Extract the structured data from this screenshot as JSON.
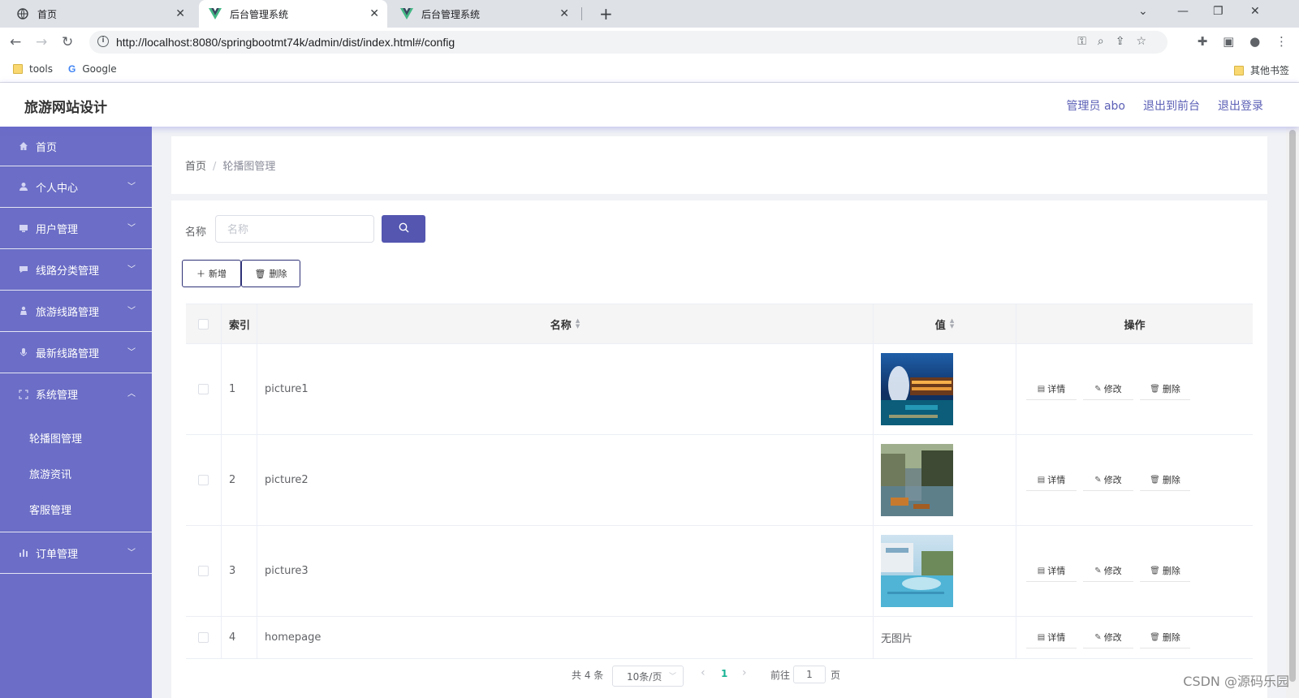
{
  "browser": {
    "tabs": [
      {
        "label": "首页",
        "icon": "globe-icon"
      },
      {
        "label": "后台管理系统",
        "icon": "vue-icon"
      },
      {
        "label": "后台管理系统",
        "icon": "vue-icon"
      }
    ],
    "url": "http://localhost:8080/springbootmt74k/admin/dist/index.html#/config",
    "bookmarks": [
      {
        "label": "tools",
        "icon": "folder-icon"
      },
      {
        "label": "Google",
        "icon": "google-icon"
      }
    ],
    "other_bookmarks": "其他书签"
  },
  "app": {
    "title": "旅游网站设计",
    "header_links": {
      "user": "管理员 abo",
      "to_front": "退出到前台",
      "logout": "退出登录"
    }
  },
  "sidebar": {
    "items": [
      {
        "label": "首页",
        "icon": "home-icon"
      },
      {
        "label": "个人中心",
        "icon": "user-icon"
      },
      {
        "label": "用户管理",
        "icon": "monitor-icon"
      },
      {
        "label": "线路分类管理",
        "icon": "chat-icon"
      },
      {
        "label": "旅游线路管理",
        "icon": "person-icon"
      },
      {
        "label": "最新线路管理",
        "icon": "mic-icon"
      },
      {
        "label": "系统管理",
        "icon": "fullscreen-icon"
      }
    ],
    "sub_items": [
      "轮播图管理",
      "旅游资讯",
      "客服管理"
    ],
    "last_item": {
      "label": "订单管理",
      "icon": "bar-chart-icon"
    }
  },
  "breadcrumb": {
    "home": "首页",
    "separator": "/",
    "current": "轮播图管理"
  },
  "search": {
    "label": "名称",
    "placeholder": "名称"
  },
  "actions": {
    "add": "新增",
    "delete": "删除"
  },
  "table": {
    "headers": {
      "index": "索引",
      "name": "名称",
      "value": "值",
      "ops": "操作"
    },
    "rows": [
      {
        "index": "1",
        "name": "picture1",
        "value": null,
        "image": "resort-night"
      },
      {
        "index": "2",
        "name": "picture2",
        "value": null,
        "image": "water-town"
      },
      {
        "index": "3",
        "name": "picture3",
        "value": null,
        "image": "pool-villa"
      },
      {
        "index": "4",
        "name": "homepage",
        "value": "无图片",
        "image": null
      }
    ],
    "op_labels": {
      "detail": "详情",
      "edit": "修改",
      "delete": "删除"
    }
  },
  "pagination": {
    "total": "共 4 条",
    "page_size": "10条/页",
    "current": "1",
    "goto": "前往",
    "jump_value": "1",
    "page_unit": "页"
  },
  "watermark": "CSDN @源码乐园",
  "colors": {
    "sidebar": "#6b6dc6",
    "primary": "#5456b0",
    "pager_active": "#1ab394"
  }
}
